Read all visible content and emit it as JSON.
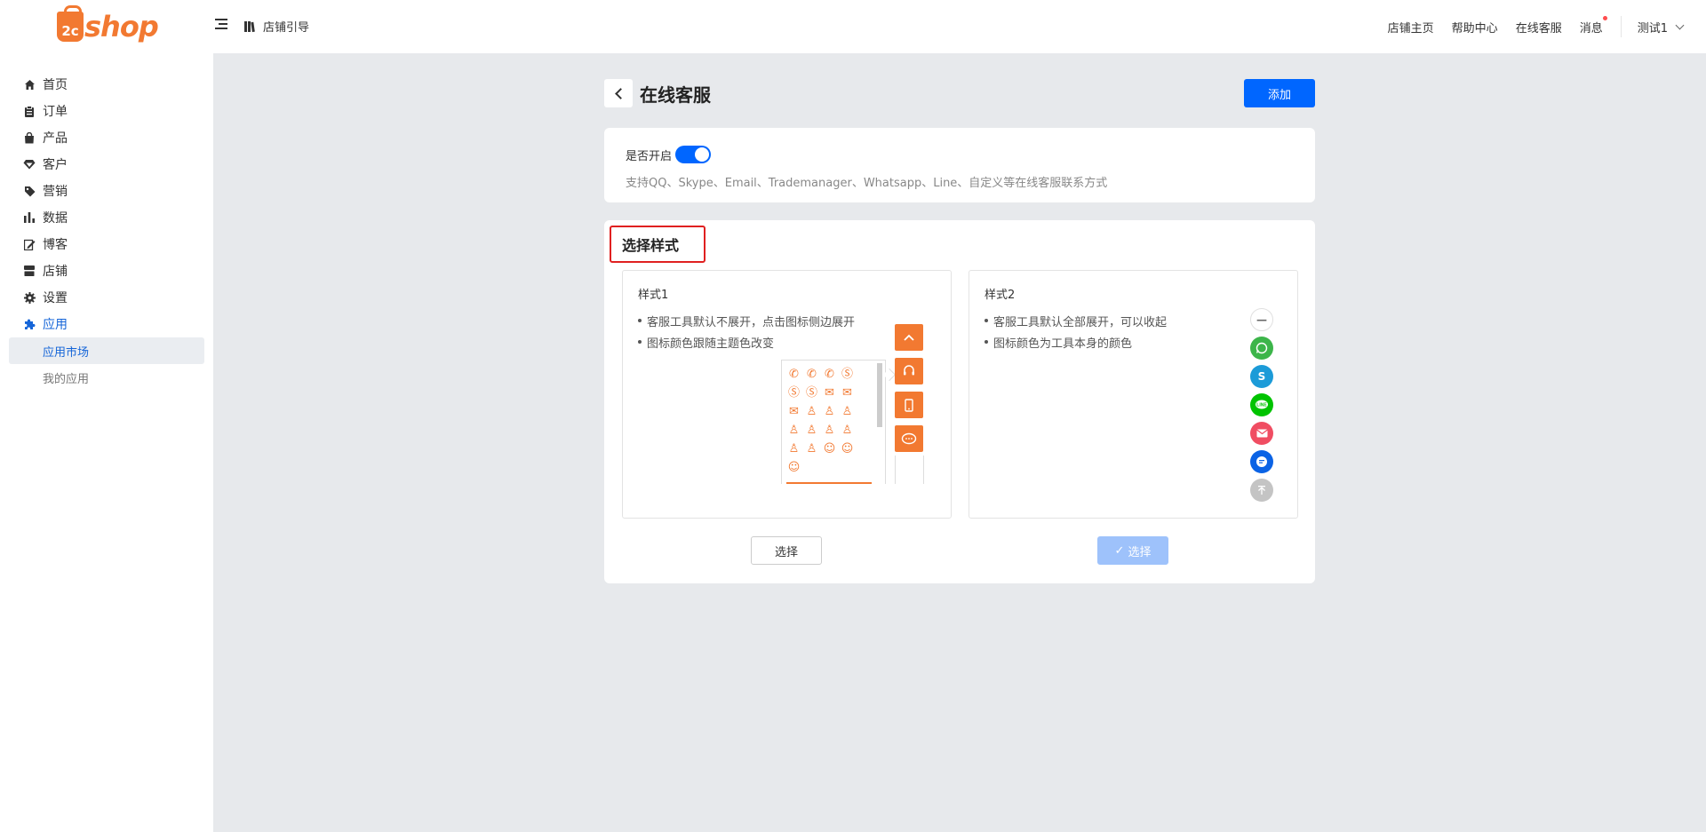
{
  "brand": {
    "badge": "2c",
    "name": "shop"
  },
  "header": {
    "guide_label": "店铺引导",
    "links": [
      "店铺主页",
      "帮助中心",
      "在线客服",
      "消息"
    ],
    "user": "测试1"
  },
  "sidebar": {
    "items": [
      {
        "label": "首页",
        "icon": "home-icon"
      },
      {
        "label": "订单",
        "icon": "clipboard-icon"
      },
      {
        "label": "产品",
        "icon": "bag-icon"
      },
      {
        "label": "客户",
        "icon": "diamond-icon"
      },
      {
        "label": "营销",
        "icon": "tag-icon"
      },
      {
        "label": "数据",
        "icon": "bar-chart-icon"
      },
      {
        "label": "博客",
        "icon": "edit-icon"
      },
      {
        "label": "店铺",
        "icon": "store-icon"
      },
      {
        "label": "设置",
        "icon": "gear-icon"
      },
      {
        "label": "应用",
        "icon": "puzzle-icon",
        "active": true
      }
    ],
    "sub_items": [
      {
        "label": "应用市场",
        "active": true
      },
      {
        "label": "我的应用"
      }
    ]
  },
  "page": {
    "title": "在线客服",
    "add_label": "添加",
    "toggle_label": "是否开启",
    "toggle_on": true,
    "toggle_desc": "支持QQ、Skype、Email、Trademanager、Whatsapp、Line、自定义等在线客服联系方式",
    "section_title": "选择样式"
  },
  "styles": [
    {
      "name": "样式1",
      "bullets": [
        "客服工具默认不展开，点击图标侧边展开",
        "图标颜色跟随主题色改变"
      ],
      "button": "选择",
      "selected": false,
      "accent": "#f27931"
    },
    {
      "name": "样式2",
      "bullets": [
        "客服工具默认全部展开，可以收起",
        "图标颜色为工具本身的颜色"
      ],
      "button": "选择",
      "selected": true,
      "icon_colors": [
        "#3cb54a",
        "#1c9bd8",
        "#00c300",
        "#f04d62",
        "#0b63e5",
        "#c4c4c4"
      ]
    }
  ],
  "colors": {
    "primary": "#0066ff",
    "highlight": "#e02020"
  }
}
